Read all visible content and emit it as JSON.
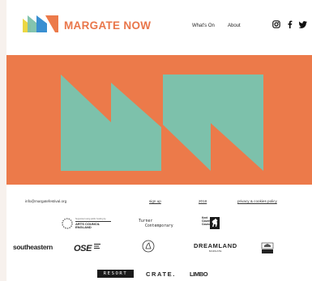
{
  "brand": {
    "name": "MARGATE NOW",
    "logo_icon": "mn-logo-icon"
  },
  "nav": {
    "items": [
      "What's On",
      "About"
    ]
  },
  "social": {
    "icons": [
      "instagram-icon",
      "facebook-icon",
      "twitter-icon"
    ]
  },
  "colors": {
    "accent": "#ec7a4a",
    "teal": "#7dc1ab",
    "yellow": "#ecd743",
    "blue": "#3a8fd1"
  },
  "footer": {
    "email": "info@margatefestival.org",
    "signup": "sign up",
    "year": "2018",
    "privacy": "privacy & cookies policy"
  },
  "sponsors": {
    "arts_council_small": "Supported using public funding by",
    "arts_council_line1": "ARTS COUNCIL",
    "arts_council_line2": "ENGLAND",
    "turner_line1": "Turner",
    "turner_line2": "Contemporary",
    "kent_line1": "Kent",
    "kent_line2": "County",
    "kent_line3": "Council",
    "southeastern": "southeastern",
    "ose": "OSE",
    "dreamland": "DREAMLAND",
    "dreamland_sub": "MARGATE",
    "resort": "RESORT",
    "crate": "CRATE.",
    "limbo": "LIMBO"
  }
}
